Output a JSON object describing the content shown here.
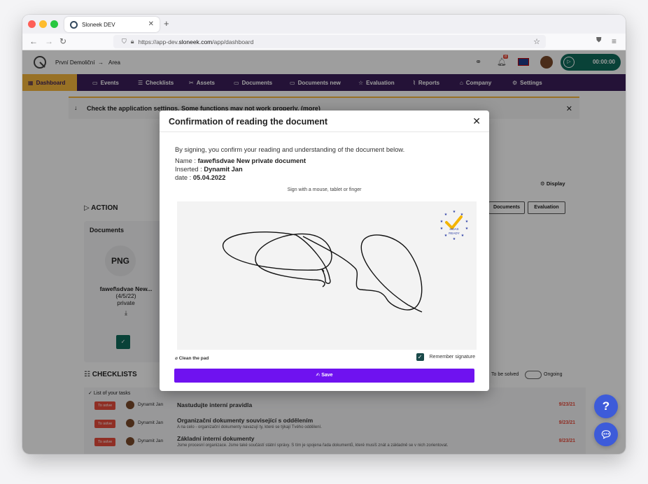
{
  "browser": {
    "tab_title": "Sloneek DEV",
    "url_prefix": "https://app-dev.",
    "url_domain": "sloneek.com",
    "url_path": "/app/dashboard"
  },
  "app_header": {
    "breadcrumb_company": "První Demoliční",
    "breadcrumb_arrow": "→",
    "breadcrumb_area": "Area",
    "notification_count": "8",
    "timer": "00:00:00"
  },
  "menu": {
    "items": [
      "Dashboard",
      "Events",
      "Checklists",
      "Assets",
      "Documents",
      "Documents new",
      "Evaluation",
      "Reports",
      "Company",
      "Settings"
    ]
  },
  "banner": {
    "text": "Check the application settings. Some functions may not work properly. (more)"
  },
  "background": {
    "display_link": "Display",
    "action_title": "ACTION",
    "documents_title": "Documents",
    "doc_ext": "PNG",
    "doc_name": "fawef\\sdvae New...",
    "doc_date": "(4/5/22)",
    "doc_visibility": "private",
    "btn_documents": "Documents",
    "btn_evaluation": "Evaluation",
    "checklists_title": "CHECKLISTS",
    "to_be_solved": "To be solved",
    "ongoing": "Ongoing",
    "list_label": "List of your tasks",
    "tasks": [
      {
        "badge": "To solve",
        "user": "Dynamit Jan",
        "title": "Nastudujte interní pravidla",
        "subtitle": "",
        "date": "9/23/21"
      },
      {
        "badge": "To solve",
        "user": "Dynamit Jan",
        "title": "Organizační dokumenty související s oddělením",
        "subtitle": "A na celo - organizační dokumenty navazují ty, které se týkají Tvého oddělení.",
        "date": "9/23/21"
      },
      {
        "badge": "To solve",
        "user": "Dynamit Jan",
        "title": "Základní interní dokumenty",
        "subtitle": "Jsme procesní organizace. Jsme také součástí státní správy. S tím je spojena řada dokumentů, které musíš znát a základně se v nich zorientovat.",
        "date": "9/23/21"
      }
    ]
  },
  "modal": {
    "title": "Confirmation of reading the document",
    "close": "✕",
    "intro": "By signing, you confirm your reading and understanding of the document below.",
    "name_label": "Name :",
    "name_value": "fawef\\sdvae New private document",
    "inserted_label": "Inserted :",
    "inserted_value": "Dynamit Jan",
    "date_label": "date :",
    "date_value": "05.04.2022",
    "sign_hint": "Sign with a mouse, tablet or finger",
    "eidas_line1": "eIDAS",
    "eidas_line2": "READY",
    "clean_pad": "Clean the pad",
    "remember_signature": "Remember signature",
    "save": "Save"
  },
  "colors": {
    "menu_bg": "#3b1e5a",
    "menu_active": "#f6b73c",
    "save_btn": "#6f12f0",
    "timer_bg": "#0f6b5b",
    "help_btn": "#3d5bd9"
  }
}
